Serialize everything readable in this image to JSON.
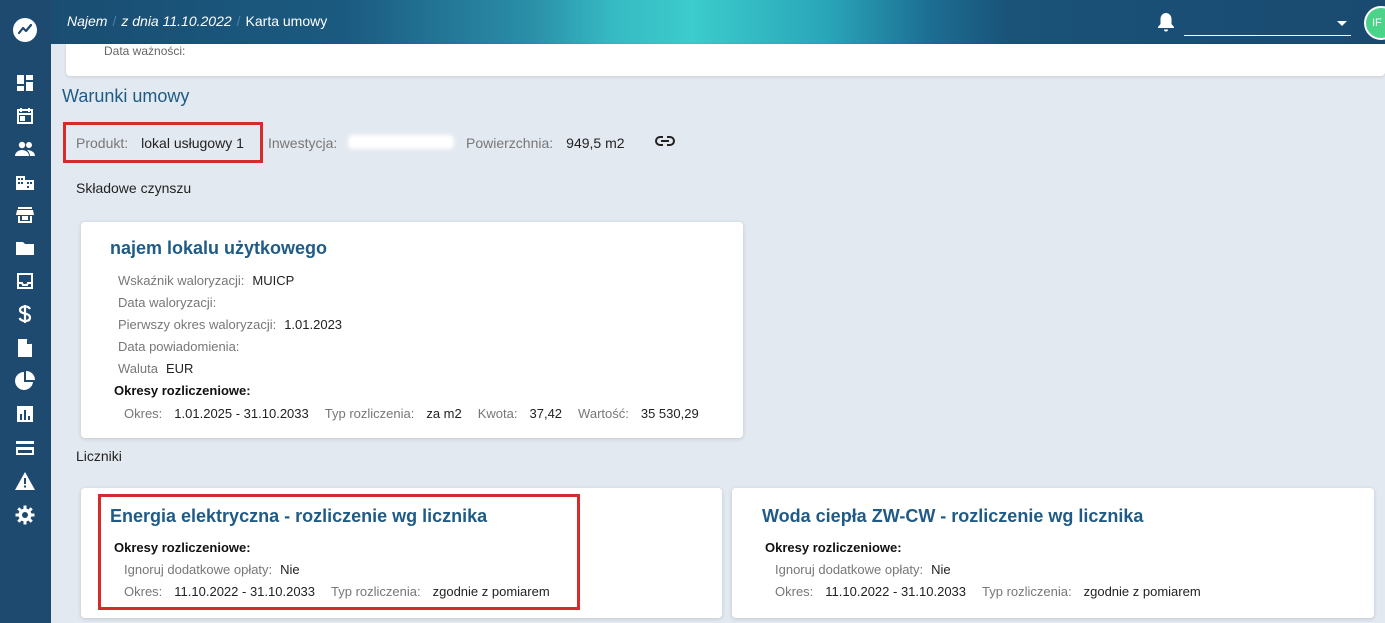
{
  "header": {
    "crumb1": "Najem",
    "crumb2": "z dnia 11.10.2022",
    "crumb3": "Karta umowy",
    "avatar_initials": "IF"
  },
  "top_card": {
    "expiry_label": "Data ważności:"
  },
  "section": {
    "title": "Warunki umowy"
  },
  "product": {
    "product_label": "Produkt:",
    "product_value": "lokal usługowy 1",
    "investment_label": "Inwestycja:",
    "area_label": "Powierzchnia:",
    "area_value": "949,5 m2"
  },
  "rent": {
    "heading": "Składowe czynszu",
    "card": {
      "title": "najem lokalu użytkowego",
      "index_label": "Wskaźnik waloryzacji:",
      "index_value": "MUICP",
      "valorization_date_label": "Data waloryzacji:",
      "first_period_label": "Pierwszy okres waloryzacji:",
      "first_period_value": "1.01.2023",
      "notification_date_label": "Data powiadomienia:",
      "currency_label": "Waluta",
      "currency_value": "EUR",
      "periods_label": "Okresy rozliczeniowe:",
      "period_label": "Okres:",
      "period_value": "1.01.2025 - 31.10.2033",
      "type_label": "Typ rozliczenia:",
      "type_value": "za m2",
      "amount_label": "Kwota:",
      "amount_value": "37,42",
      "value_label": "Wartość:",
      "value_value": "35 530,29"
    }
  },
  "meters": {
    "heading": "Liczniki",
    "cards": [
      {
        "title": "Energia elektryczna - rozliczenie wg licznika",
        "periods_label": "Okresy rozliczeniowe:",
        "ignore_label": "Ignoruj dodatkowe opłaty:",
        "ignore_value": "Nie",
        "period_label": "Okres:",
        "period_value": "11.10.2022 - 31.10.2033",
        "type_label": "Typ rozliczenia:",
        "type_value": "zgodnie z pomiarem"
      },
      {
        "title": "Woda ciepła ZW-CW - rozliczenie wg licznika",
        "periods_label": "Okresy rozliczeniowe:",
        "ignore_label": "Ignoruj dodatkowe opłaty:",
        "ignore_value": "Nie",
        "period_label": "Okres:",
        "period_value": "11.10.2022 - 31.10.2033",
        "type_label": "Typ rozliczenia:",
        "type_value": "zgodnie z pomiarem"
      }
    ]
  },
  "sidebar": {
    "icons": [
      "dashboard-icon",
      "calendar-icon",
      "people-icon",
      "buildings-icon",
      "store-icon",
      "folder-icon",
      "inbox-icon",
      "dollar-icon",
      "document-icon",
      "pie-chart-icon",
      "bar-chart-icon",
      "credit-card-icon",
      "warning-icon",
      "settings-icon"
    ]
  },
  "colors": {
    "sidebar": "#1e4a6f",
    "title": "#1f5b86",
    "highlight": "#d62b2b",
    "avatar": "#4cd38a"
  }
}
